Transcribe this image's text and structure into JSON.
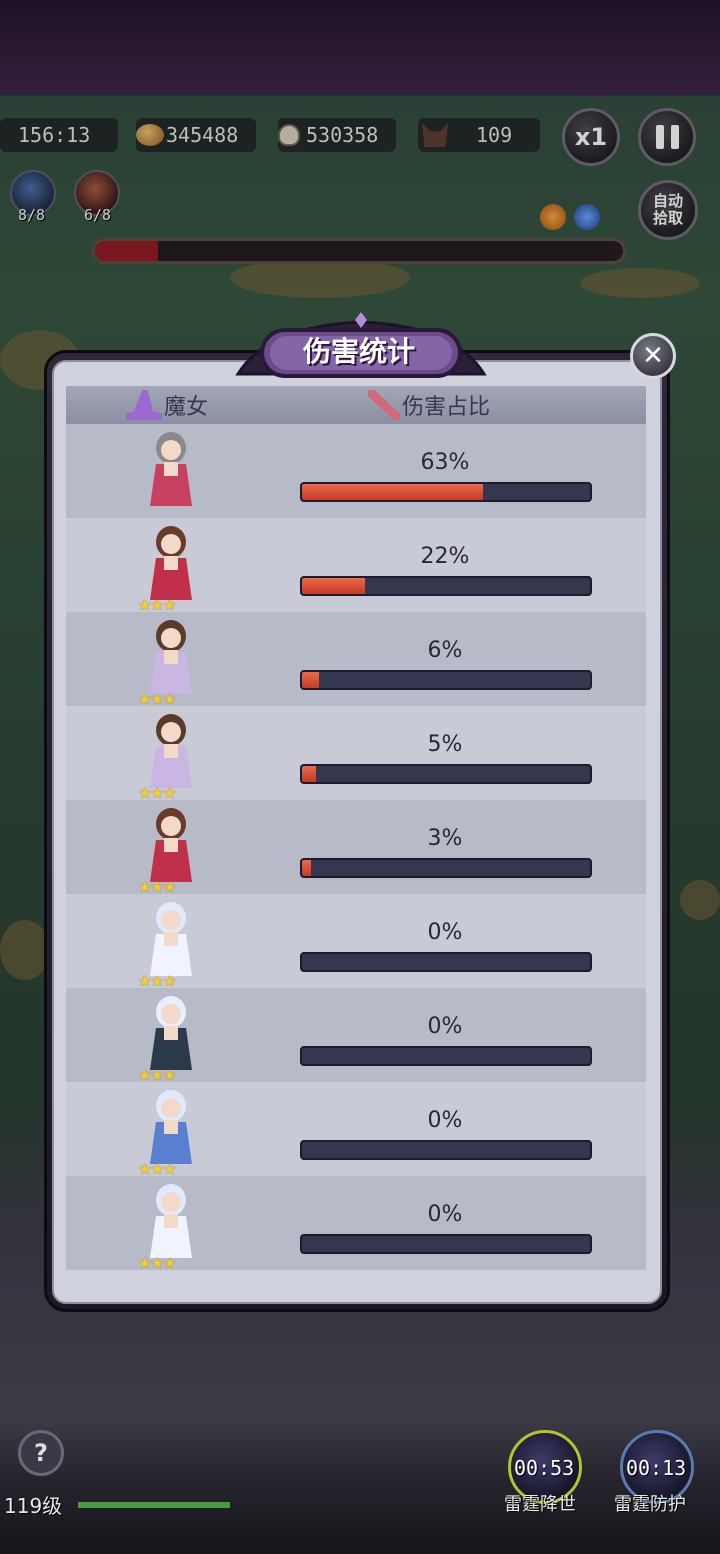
{
  "hud": {
    "timer": "156:13",
    "coins": "345488",
    "skulls": "530358",
    "enemies": "109",
    "speed_label": "x1",
    "auto_pickup_label": "自动\n拾取",
    "auto_pickup_line1": "自动",
    "auto_pickup_line2": "拾取",
    "skills": [
      {
        "icon": "lightning-skill-icon",
        "count": "8/8"
      },
      {
        "icon": "vortex-skill-icon",
        "count": "6/8"
      }
    ]
  },
  "panel": {
    "title": "伤害统计",
    "col_witch": "魔女",
    "col_damage": "伤害占比",
    "rows": [
      {
        "hero": "witch-crimson-hair-ornament",
        "stars": 0,
        "percent": "63%",
        "fraction": 0.63,
        "colors": {
          "hair": "#8a8a8a",
          "outfit": "#c84060"
        }
      },
      {
        "hero": "spear-fighter-brown",
        "stars": 3,
        "percent": "22%",
        "fraction": 0.22,
        "colors": {
          "hair": "#6a3a2a",
          "outfit": "#c0304a"
        }
      },
      {
        "hero": "horned-girl-lavender",
        "stars": 3,
        "percent": "6%",
        "fraction": 0.06,
        "colors": {
          "hair": "#5a3a2a",
          "outfit": "#c9b6e2"
        }
      },
      {
        "hero": "horned-girl-lavender",
        "stars": 3,
        "percent": "5%",
        "fraction": 0.05,
        "colors": {
          "hair": "#5a3a2a",
          "outfit": "#c9b6e2"
        }
      },
      {
        "hero": "spear-fighter-brown",
        "stars": 3,
        "percent": "3%",
        "fraction": 0.03,
        "colors": {
          "hair": "#6a3a2a",
          "outfit": "#c0304a"
        }
      },
      {
        "hero": "ice-maiden-white",
        "stars": 3,
        "percent": "0%",
        "fraction": 0,
        "colors": {
          "hair": "#dfe9ff",
          "outfit": "#f0f4ff"
        }
      },
      {
        "hero": "trident-warrior-silver",
        "stars": 3,
        "percent": "0%",
        "fraction": 0,
        "colors": {
          "hair": "#e8f0ff",
          "outfit": "#2a3a4a"
        }
      },
      {
        "hero": "ice-maiden-blue",
        "stars": 3,
        "percent": "0%",
        "fraction": 0,
        "colors": {
          "hair": "#dfe9ff",
          "outfit": "#5a7fd0"
        }
      },
      {
        "hero": "ice-maiden-white",
        "stars": 3,
        "percent": "0%",
        "fraction": 0,
        "colors": {
          "hair": "#dfe9ff",
          "outfit": "#f0f4ff"
        }
      }
    ]
  },
  "bottom": {
    "level": "119级",
    "skills": [
      {
        "timer": "00:53",
        "name": "雷霆降世"
      },
      {
        "timer": "00:13",
        "name": "雷霆防护"
      }
    ]
  },
  "colors": {
    "bar_fill": "#d44a30",
    "bar_track": "#353650",
    "star": "#f6cf2e",
    "plaque": "#6a4b8c"
  }
}
